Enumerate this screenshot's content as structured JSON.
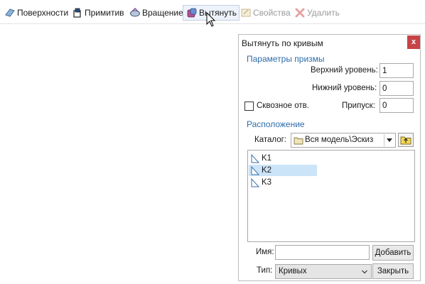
{
  "toolbar": {
    "items": [
      {
        "label": "Поверхности",
        "icon": "surfaces-icon",
        "state": "normal"
      },
      {
        "label": "Примитив",
        "icon": "primitive-icon",
        "state": "normal"
      },
      {
        "label": "Вращение",
        "icon": "rotation-icon",
        "state": "normal"
      },
      {
        "label": "Вытянуть",
        "icon": "extrude-icon",
        "state": "hover"
      },
      {
        "label": "Свойства",
        "icon": "properties-icon",
        "state": "disabled"
      },
      {
        "label": "Удалить",
        "icon": "delete-icon",
        "state": "disabled"
      }
    ]
  },
  "panel": {
    "title": "Вытянуть по кривым",
    "close_label": "x",
    "prism_section": "Параметры призмы",
    "top_level_label": "Верхний уровень:",
    "top_level_value": "1",
    "bottom_level_label": "Нижний уровень:",
    "bottom_level_value": "0",
    "through_hole_label": "Сквозное отв.",
    "through_hole_checked": false,
    "allowance_label": "Припуск:",
    "allowance_value": "0",
    "location_section": "Расположение",
    "catalog_label": "Каталог:",
    "catalog_value": "Вся модель\\Эскиз",
    "curves": [
      {
        "label": "K1",
        "selected": false
      },
      {
        "label": "K2",
        "selected": true
      },
      {
        "label": "K3",
        "selected": false
      }
    ],
    "name_label": "Имя:",
    "name_value": "",
    "add_button": "Добавить",
    "type_label": "Тип:",
    "type_value": "Кривых",
    "close_button": "Закрыть"
  },
  "colors": {
    "section_heading": "#2d6bab",
    "close_button": "#c64346",
    "selection": "#cce4f7"
  }
}
